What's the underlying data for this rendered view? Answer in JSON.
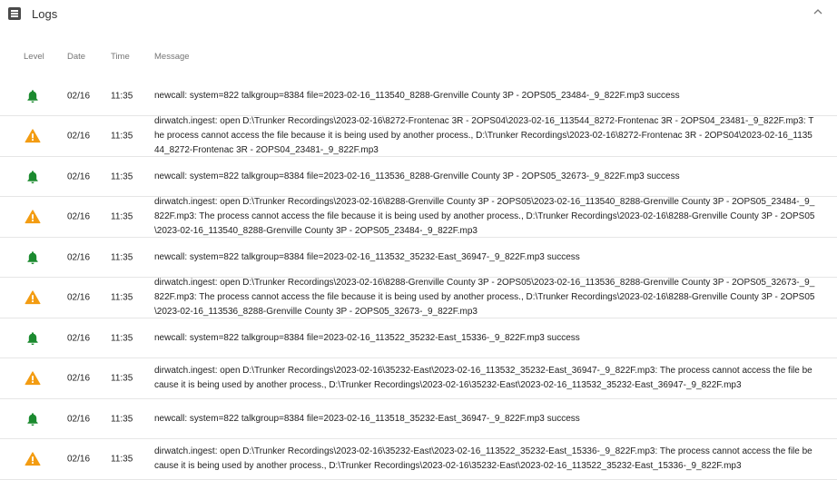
{
  "header": {
    "title": "Logs",
    "icon": "logs-icon"
  },
  "columns": {
    "level": "Level",
    "date": "Date",
    "time": "Time",
    "message": "Message"
  },
  "colors": {
    "info": "#1b8a2f",
    "warning": "#f39c12"
  },
  "rows": [
    {
      "level": "info",
      "date": "02/16",
      "time": "11:35",
      "message": "newcall: system=822 talkgroup=8384 file=2023-02-16_113540_8288-Grenville County 3P - 2OPS05_23484-_9_822F.mp3 success"
    },
    {
      "level": "warning",
      "date": "02/16",
      "time": "11:35",
      "message": "dirwatch.ingest: open D:\\Trunker Recordings\\2023-02-16\\8272-Frontenac 3R - 2OPS04\\2023-02-16_113544_8272-Frontenac 3R - 2OPS04_23481-_9_822F.mp3: The process cannot access the file because it is being used by another process., D:\\Trunker Recordings\\2023-02-16\\8272-Frontenac 3R - 2OPS04\\2023-02-16_113544_8272-Frontenac 3R - 2OPS04_23481-_9_822F.mp3"
    },
    {
      "level": "info",
      "date": "02/16",
      "time": "11:35",
      "message": "newcall: system=822 talkgroup=8384 file=2023-02-16_113536_8288-Grenville County 3P - 2OPS05_32673-_9_822F.mp3 success"
    },
    {
      "level": "warning",
      "date": "02/16",
      "time": "11:35",
      "message": "dirwatch.ingest: open D:\\Trunker Recordings\\2023-02-16\\8288-Grenville County 3P - 2OPS05\\2023-02-16_113540_8288-Grenville County 3P - 2OPS05_23484-_9_822F.mp3: The process cannot access the file because it is being used by another process., D:\\Trunker Recordings\\2023-02-16\\8288-Grenville County 3P - 2OPS05\\2023-02-16_113540_8288-Grenville County 3P - 2OPS05_23484-_9_822F.mp3"
    },
    {
      "level": "info",
      "date": "02/16",
      "time": "11:35",
      "message": "newcall: system=822 talkgroup=8384 file=2023-02-16_113532_35232-East_36947-_9_822F.mp3 success"
    },
    {
      "level": "warning",
      "date": "02/16",
      "time": "11:35",
      "message": "dirwatch.ingest: open D:\\Trunker Recordings\\2023-02-16\\8288-Grenville County 3P - 2OPS05\\2023-02-16_113536_8288-Grenville County 3P - 2OPS05_32673-_9_822F.mp3: The process cannot access the file because it is being used by another process., D:\\Trunker Recordings\\2023-02-16\\8288-Grenville County 3P - 2OPS05\\2023-02-16_113536_8288-Grenville County 3P - 2OPS05_32673-_9_822F.mp3"
    },
    {
      "level": "info",
      "date": "02/16",
      "time": "11:35",
      "message": "newcall: system=822 talkgroup=8384 file=2023-02-16_113522_35232-East_15336-_9_822F.mp3 success"
    },
    {
      "level": "warning",
      "date": "02/16",
      "time": "11:35",
      "message": "dirwatch.ingest: open D:\\Trunker Recordings\\2023-02-16\\35232-East\\2023-02-16_113532_35232-East_36947-_9_822F.mp3: The process cannot access the file because it is being used by another process., D:\\Trunker Recordings\\2023-02-16\\35232-East\\2023-02-16_113532_35232-East_36947-_9_822F.mp3"
    },
    {
      "level": "info",
      "date": "02/16",
      "time": "11:35",
      "message": "newcall: system=822 talkgroup=8384 file=2023-02-16_113518_35232-East_36947-_9_822F.mp3 success"
    },
    {
      "level": "warning",
      "date": "02/16",
      "time": "11:35",
      "message": "dirwatch.ingest: open D:\\Trunker Recordings\\2023-02-16\\35232-East\\2023-02-16_113522_35232-East_15336-_9_822F.mp3: The process cannot access the file because it is being used by another process., D:\\Trunker Recordings\\2023-02-16\\35232-East\\2023-02-16_113522_35232-East_15336-_9_822F.mp3"
    }
  ]
}
